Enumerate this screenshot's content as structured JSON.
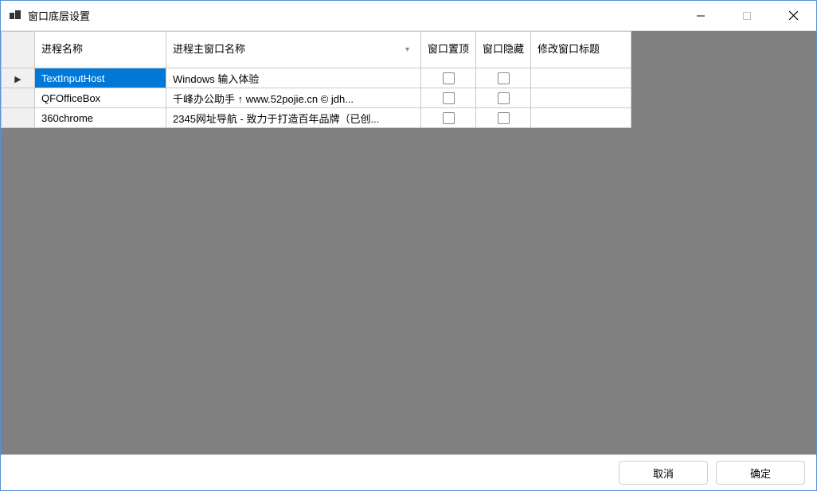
{
  "window": {
    "title": "窗口底层设置"
  },
  "columns": {
    "process_name": "进程名称",
    "main_window_title": "进程主窗口名称",
    "topmost": "窗口置顶",
    "hidden": "窗口隐藏",
    "modify_title": "修改窗口标题"
  },
  "rows": [
    {
      "process_name": "TextInputHost",
      "main_window_title": "Windows 输入体验",
      "topmost": false,
      "hidden": false,
      "modify_title": "",
      "selected": true,
      "current": true
    },
    {
      "process_name": "QFOfficeBox",
      "main_window_title": "千峰办公助手   ↑ www.52pojie.cn © jdh...",
      "topmost": false,
      "hidden": false,
      "modify_title": "",
      "selected": false,
      "current": false
    },
    {
      "process_name": "360chrome",
      "main_window_title": "2345网址导航 - 致力于打造百年品牌（已创...",
      "topmost": false,
      "hidden": false,
      "modify_title": "",
      "selected": false,
      "current": false
    }
  ],
  "footer": {
    "cancel": "取消",
    "ok": "确定"
  }
}
